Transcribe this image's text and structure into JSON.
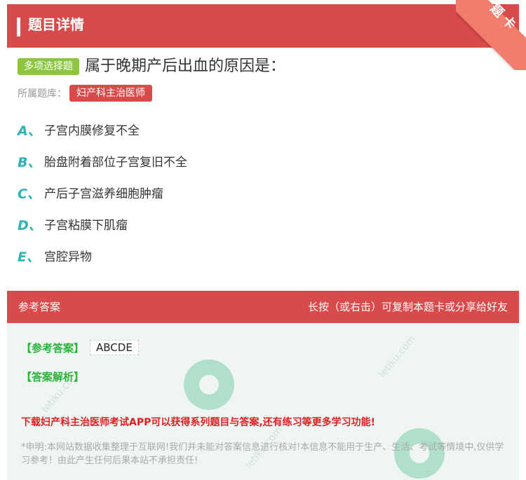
{
  "header": {
    "title": "题目详情",
    "corner_label": "题卡"
  },
  "question": {
    "type_tag": "多项选择题",
    "text": "属于晚期产后出血的原因是：",
    "bank_label": "所属题库：",
    "bank_name": "妇产科主治医师"
  },
  "options": [
    {
      "letter": "A、",
      "text": "子宫内膜修复不全"
    },
    {
      "letter": "B、",
      "text": "胎盘附着部位子宫复旧不全"
    },
    {
      "letter": "C、",
      "text": "产后子宫滋养细胞肿瘤"
    },
    {
      "letter": "D、",
      "text": "子宫粘膜下肌瘤"
    },
    {
      "letter": "E、",
      "text": "宫腔异物"
    }
  ],
  "answer_section": {
    "header_left": "参考答案",
    "header_right": "长按（或右击）可复制本题卡或分享给好友",
    "answer_label": "【参考答案】",
    "answer_value": "ABCDE",
    "analysis_label": "【答案解析】",
    "promo": "下载妇产科主治医师考试APP可以获得系列题目与答案,还有练习等更多学习功能!",
    "disclaimer": "*申明:本网站数据收集整理于互联网!我们并未能对答案信息进行核对!本信息不能用于生产、生活、考试等情境中,仅供学习参考！由此产生任何后果本站不承担责任!",
    "watermark": "letiku.com"
  },
  "colors": {
    "primary_red": "#d94a4a",
    "tag_green": "#8cc63f",
    "letter_teal": "#2bb3b8",
    "answer_green": "#2bb33a"
  }
}
